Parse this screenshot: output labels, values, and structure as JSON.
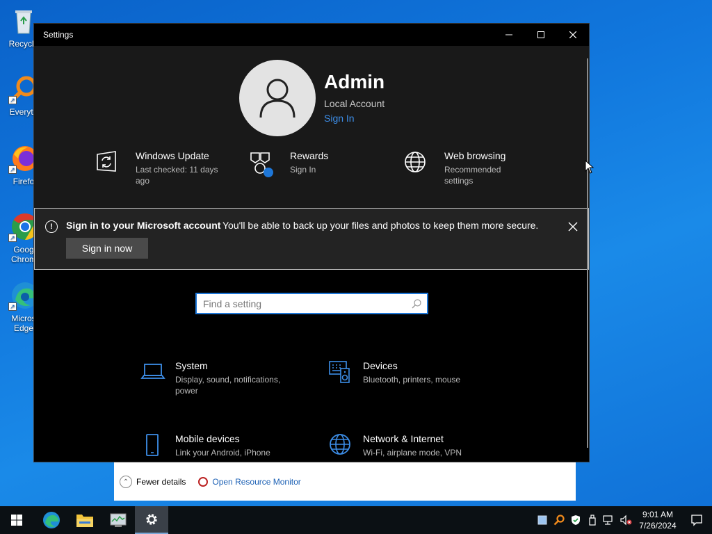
{
  "desktop": {
    "icons": [
      {
        "label": "Recycle",
        "icon": "recycle-bin-icon"
      },
      {
        "label": "Everyth",
        "icon": "everything-search-icon"
      },
      {
        "label": "Firefo",
        "icon": "firefox-icon"
      },
      {
        "label": "Goog Chrom",
        "icon": "chrome-icon"
      },
      {
        "label": "Micros Edge",
        "icon": "edge-icon"
      }
    ]
  },
  "background_window": {
    "fewer_details": "Fewer details",
    "resource_monitor": "Open Resource Monitor"
  },
  "settings": {
    "title": "Settings",
    "account": {
      "name": "Admin",
      "type": "Local Account",
      "sign_in": "Sign In"
    },
    "quick_links": [
      {
        "title": "Windows Update",
        "subtitle": "Last checked: 11 days ago",
        "icon": "windows-update-icon"
      },
      {
        "title": "Rewards",
        "subtitle": "Sign In",
        "icon": "rewards-icon"
      },
      {
        "title": "Web browsing",
        "subtitle": "Recommended settings",
        "icon": "globe-icon"
      }
    ],
    "banner": {
      "title": "Sign in to your Microsoft account",
      "message": "You'll be able to back up your files and photos to keep them more secure.",
      "button": "Sign in now"
    },
    "search": {
      "placeholder": "Find a setting"
    },
    "categories": [
      {
        "title": "System",
        "subtitle": "Display, sound, notifications, power",
        "icon": "laptop-icon"
      },
      {
        "title": "Devices",
        "subtitle": "Bluetooth, printers, mouse",
        "icon": "keyboard-speaker-icon"
      },
      {
        "title": "Mobile devices",
        "subtitle": "Link your Android, iPhone",
        "icon": "phone-icon"
      },
      {
        "title": "Network & Internet",
        "subtitle": "Wi-Fi, airplane mode, VPN",
        "icon": "globe-icon"
      }
    ],
    "accent_color": "#1e77d8"
  },
  "taskbar": {
    "clock": {
      "time": "9:01 AM",
      "date": "7/26/2024"
    }
  }
}
